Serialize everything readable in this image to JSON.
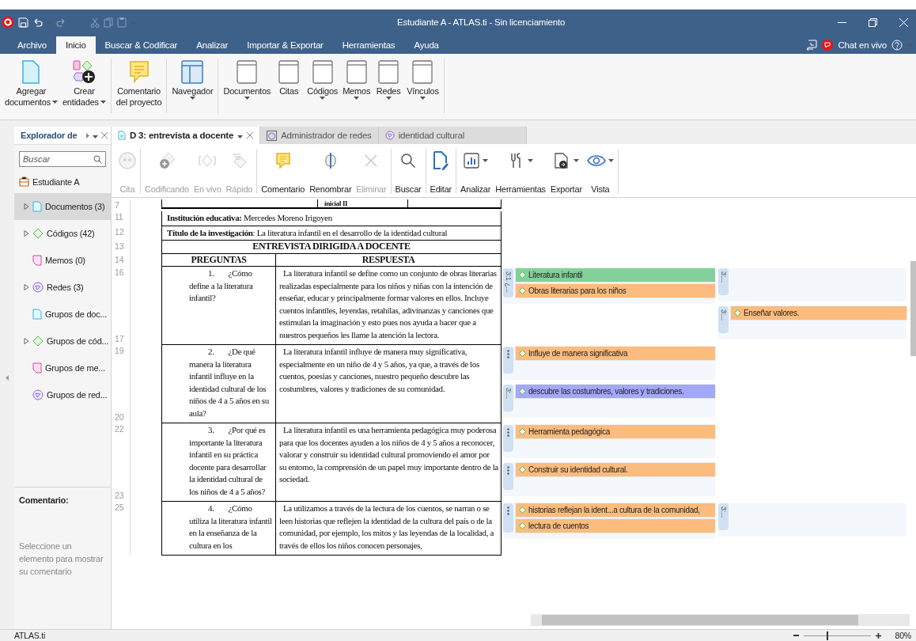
{
  "window": {
    "title": "Estudiante A - ATLAS.ti - Sin licenciamiento"
  },
  "menu": {
    "items": [
      {
        "label": "Archivo",
        "selected": false
      },
      {
        "label": "Inicio",
        "selected": true
      },
      {
        "label": "Buscar & Codificar",
        "selected": false
      },
      {
        "label": "Analizar",
        "selected": false
      },
      {
        "label": "Importar & Exportar",
        "selected": false
      },
      {
        "label": "Herramientas",
        "selected": false
      },
      {
        "label": "Ayuda",
        "selected": false
      }
    ],
    "chat": "Chat en vivo"
  },
  "ribbon": {
    "groups": [
      [
        {
          "lines": [
            "Agregar",
            "documentos"
          ],
          "dropdown": true
        },
        {
          "lines": [
            "Crear",
            "entidades"
          ],
          "dropdown": true
        }
      ],
      [
        {
          "lines": [
            "Comentario",
            "del proyecto"
          ],
          "dropdown": false
        }
      ],
      [
        {
          "lines": [
            "Navegador"
          ],
          "dropdown": true
        }
      ],
      [
        {
          "lines": [
            "Documentos"
          ],
          "dropdown": true
        },
        {
          "lines": [
            "Citas"
          ],
          "dropdown": false
        },
        {
          "lines": [
            "Códigos"
          ],
          "dropdown": true
        },
        {
          "lines": [
            "Memos"
          ],
          "dropdown": true
        },
        {
          "lines": [
            "Redes"
          ],
          "dropdown": true
        },
        {
          "lines": [
            "Vínculos"
          ],
          "dropdown": true
        }
      ]
    ]
  },
  "sidebar": {
    "title": "Explorador de",
    "search": {
      "placeholder": "Buscar"
    },
    "root": "Estudiante A",
    "items": [
      {
        "label": "Documentos (3)",
        "expandable": true,
        "selected": true
      },
      {
        "label": "Códigos (42)",
        "expandable": true,
        "selected": false
      },
      {
        "label": "Memos (0)",
        "expandable": false,
        "selected": false
      },
      {
        "label": "Redes (3)",
        "expandable": true,
        "selected": false
      },
      {
        "label": "Grupos de doc...",
        "expandable": false,
        "selected": false
      },
      {
        "label": "Grupos de cód...",
        "expandable": true,
        "selected": false
      },
      {
        "label": "Grupos de me...",
        "expandable": false,
        "selected": false
      },
      {
        "label": "Grupos de red...",
        "expandable": false,
        "selected": false
      }
    ],
    "comment_title": "Comentario:",
    "comment_placeholder": "Seleccione un elemento para mostrar su comentario"
  },
  "tabs": [
    {
      "label": "D 3: entrevista a docente",
      "selected": true
    },
    {
      "label": "Administrador de redes",
      "selected": false
    },
    {
      "label": "identidad cultural",
      "selected": false
    }
  ],
  "toolbar": {
    "groups": [
      [
        {
          "label": "Cita",
          "disabled": true,
          "dropdown": false
        }
      ],
      [
        {
          "label": "Codificando",
          "disabled": true,
          "dropdown": false
        },
        {
          "label": "En vivo",
          "disabled": true,
          "dropdown": false
        },
        {
          "label": "Rápido",
          "disabled": true,
          "dropdown": false
        }
      ],
      [
        {
          "label": "Comentario",
          "disabled": false,
          "dropdown": false
        },
        {
          "label": "Renombrar",
          "disabled": false,
          "dropdown": false
        },
        {
          "label": "Eliminar",
          "disabled": true,
          "dropdown": false
        }
      ],
      [
        {
          "label": "Buscar",
          "disabled": false,
          "dropdown": false
        }
      ],
      [
        {
          "label": "Editar",
          "disabled": false,
          "dropdown": false
        }
      ],
      [
        {
          "label": "Analizar",
          "disabled": false,
          "dropdown": true
        },
        {
          "label": "Herramientas",
          "disabled": false,
          "dropdown": true
        },
        {
          "label": "Exportar",
          "disabled": false,
          "dropdown": true
        },
        {
          "label": "Vista",
          "disabled": false,
          "dropdown": true
        }
      ]
    ]
  },
  "document": {
    "rows": [
      {
        "kind": "partial",
        "line_numbers": [
          "7"
        ],
        "text": "inicial II"
      },
      {
        "kind": "field",
        "line_numbers": [
          "11"
        ],
        "text": "**Institución educativa:** Mercedes Moreno Irigoyen"
      },
      {
        "kind": "field",
        "line_numbers": [
          "12"
        ],
        "text": "**Título de la investigación**: La literatura infantil en el desarrollo de la identidad cultural"
      },
      {
        "kind": "title",
        "line_numbers": [
          "13"
        ],
        "text": "ENTREVISTA DIRIGIDA A DOCENTE"
      },
      {
        "kind": "header",
        "line_numbers": [
          "14"
        ],
        "columns": [
          "PREGUNTAS",
          "RESPUESTA"
        ]
      },
      {
        "kind": "qa",
        "line_numbers": [
          "16",
          "17"
        ],
        "number": "1.",
        "question": "¿Cómo define a la literatura infantil?",
        "answer": "La literatura infantil se define como un conjunto de obras literarias realizadas especialmente para los niños y niñas con la intención de enseñar, educar y principalmente formar valores en ellos. Incluye cuentos infantiles, leyendas, retahílas, adivinanzas y canciones que estimulan la imaginación y esto pues nos ayuda a hacer que a nuestros pequeños les llame la atención la lectora.",
        "margin": [
          [
            {
              "bracket": {
                "kind": "label",
                "text": "3:1 ¿..."
              },
              "codes": [
                {
                  "label": "Literatura infantil",
                  "color": "#82d19a"
                },
                {
                  "label": "Obras literarias para los niños",
                  "color": "#fcbc7e"
                }
              ]
            }
          ],
          [
            {
              "bracket": {
                "kind": "label",
                "text": "3:..."
              }
            },
            {
              "bracket": {
                "kind": "label",
                "text": "3:..."
              },
              "codes": [
                {
                  "label": "Enseñar valores.",
                  "color": "#fcbc7e"
                }
              ]
            }
          ]
        ]
      },
      {
        "kind": "qa",
        "line_numbers": [
          "19",
          "20"
        ],
        "number": "2.",
        "question": "¿De qué manera la literatura infantil influye en la identidad cultural de los niños de 4 a 5 años en su aula?",
        "answer": "La literatura infantil influye de manera muy significativa, especialmente en un niño de 4 y 5 años, ya que, a través de los cuentos, poesías y canciones, nuestro pequeño descubre las costumbres, valores y tradiciones de su comunidad.",
        "margin": [
          [
            {
              "bracket": {
                "kind": "dots"
              },
              "codes": [
                {
                  "label": "Influye de manera significativa",
                  "color": "#fcbc7e"
                }
              ]
            },
            {
              "bracket": {
                "kind": "label",
                "text": "3:..."
              },
              "codes": [
                {
                  "label": "descubre las costumbres, valores y tradiciones.",
                  "color": "#a3a8f8"
                }
              ]
            }
          ]
        ]
      },
      {
        "kind": "qa",
        "line_numbers": [
          "22",
          "23"
        ],
        "number": "3.",
        "question": "¿Por qué es importante la literatura infantil en su práctica docente para desarrollar la identidad cultural de los niños de 4 a 5 años?",
        "answer": "La literatura infantil es una herramienta pedagógica muy poderosa para que los docentes ayuden a los niños de 4 y 5 años a reconocer, valorar y construir su identidad cultural promoviendo el amor por su entorno, la comprensión de un papel muy importante dentro de la sociedad.",
        "margin": [
          [
            {
              "bracket": {
                "kind": "dots"
              },
              "codes": [
                {
                  "label": "Herramienta pedagógica",
                  "color": "#fcbc7e"
                }
              ]
            },
            {
              "bracket": {
                "kind": "dots"
              },
              "codes": [
                {
                  "label": "Construir su identidad cultural.",
                  "color": "#fcbc7e"
                }
              ]
            }
          ]
        ]
      },
      {
        "kind": "qa",
        "line_numbers": [
          "25"
        ],
        "number": "4.",
        "question": "¿Cómo utiliza la literatura infantil en la enseñanza de la cultura en los",
        "answer": "La utilizamos a través de la lectura de los cuentos, se narran o se leen historias que reflejen la identidad de la cultura del país o de la comunidad, por ejemplo, los mitos y las leyendas de la localidad, a través de ellos los niños conocen personajes,",
        "margin": [
          [
            {
              "bracket": {
                "kind": "dots"
              },
              "codes": [
                {
                  "label": "historias reflejan la ident...a cultura de la comunidad,",
                  "color": "#fcbc7e"
                },
                {
                  "label": "lectura de cuentos",
                  "color": "#fcbc7e"
                }
              ]
            }
          ],
          [
            {
              "bracket": {
                "kind": "label",
                "text": "3:..."
              }
            }
          ]
        ]
      }
    ]
  },
  "status_bar": {
    "text": "ATLAS.ti",
    "zoom": {
      "level": 0.35,
      "reading": "80%"
    }
  }
}
